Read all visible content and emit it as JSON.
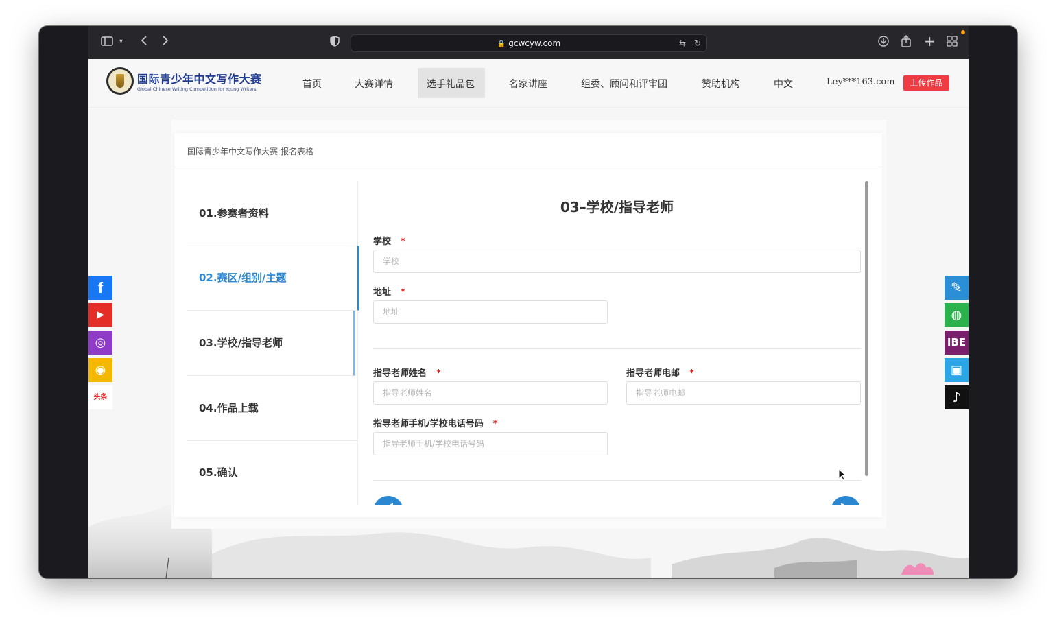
{
  "browser": {
    "url": "gcwcyw.com",
    "icons": {
      "sidebar": "sidebar-icon",
      "chevron": "chevron-down-icon",
      "back": "back-arrow-icon",
      "forward": "forward-arrow-icon",
      "shield": "shield-icon",
      "translate": "translate-icon",
      "reload": "reload-icon",
      "download": "download-icon",
      "share": "share-icon",
      "new_tab": "plus-icon",
      "tab_overview": "grid-icon"
    }
  },
  "site": {
    "logo_cn": "国际青少年中文写作大赛",
    "logo_en": "Global Chinese Writing Competition for Young Writers",
    "nav": [
      {
        "label": "首页"
      },
      {
        "label": "大赛详情"
      },
      {
        "label": "选手礼品包"
      },
      {
        "label": "名家讲座"
      },
      {
        "label": "组委、顾问和评审团"
      },
      {
        "label": "赞助机构"
      },
      {
        "label": "中文"
      },
      {
        "label": "Ley***163.com"
      }
    ],
    "active_nav_index": 2,
    "upload_button": "上传作品",
    "accent_red": "#ee3b44",
    "accent_blue": "#2a87d0"
  },
  "social_left": [
    {
      "icon": "facebook-icon",
      "color": "#1877f2",
      "glyph": "f"
    },
    {
      "icon": "youtube-icon",
      "color": "#e52d27",
      "glyph": "▶"
    },
    {
      "icon": "instagram-icon",
      "color": "#8e3cc8",
      "glyph": "◎"
    },
    {
      "icon": "weibo-icon",
      "color": "#f5b800",
      "glyph": "◉"
    },
    {
      "icon": "toutiao-icon",
      "color": "#ffffff",
      "glyph": "头条"
    }
  ],
  "social_right": [
    {
      "icon": "pen-icon",
      "color": "#2a8fd6",
      "glyph": "✎"
    },
    {
      "icon": "wechat-icon",
      "color": "#2bb24c",
      "glyph": "◍"
    },
    {
      "icon": "ibe-icon",
      "color": "#7a1f6b",
      "glyph": "IBE"
    },
    {
      "icon": "bilibili-icon",
      "color": "#2ba5e8",
      "glyph": "▣"
    },
    {
      "icon": "tiktok-icon",
      "color": "#111111",
      "glyph": "♪"
    }
  ],
  "form": {
    "card_title": "国际青少年中文写作大赛-报名表格",
    "steps": [
      {
        "label": "01.参赛者资料"
      },
      {
        "label": "02.赛区/组别/主题"
      },
      {
        "label": "03.学校/指导老师"
      },
      {
        "label": "04.作品上载"
      },
      {
        "label": "05.确认"
      }
    ],
    "active_step_index": 1,
    "section_title": "03–学校/指导老师",
    "required_mark": "*",
    "fields": {
      "school": {
        "label": "学校",
        "placeholder": "学校",
        "value": ""
      },
      "address": {
        "label": "地址",
        "placeholder": "地址",
        "value": ""
      },
      "teacher_name": {
        "label": "指导老师姓名",
        "placeholder": "指导老师姓名",
        "value": ""
      },
      "teacher_email": {
        "label": "指导老师电邮",
        "placeholder": "指导老师电邮",
        "value": ""
      },
      "teacher_phone": {
        "label": "指导老师手机/学校电话号码",
        "placeholder": "指导老师手机/学校电话号码",
        "value": ""
      }
    },
    "prev_icon": "arrow-left-icon",
    "next_icon": "arrow-right-icon"
  }
}
